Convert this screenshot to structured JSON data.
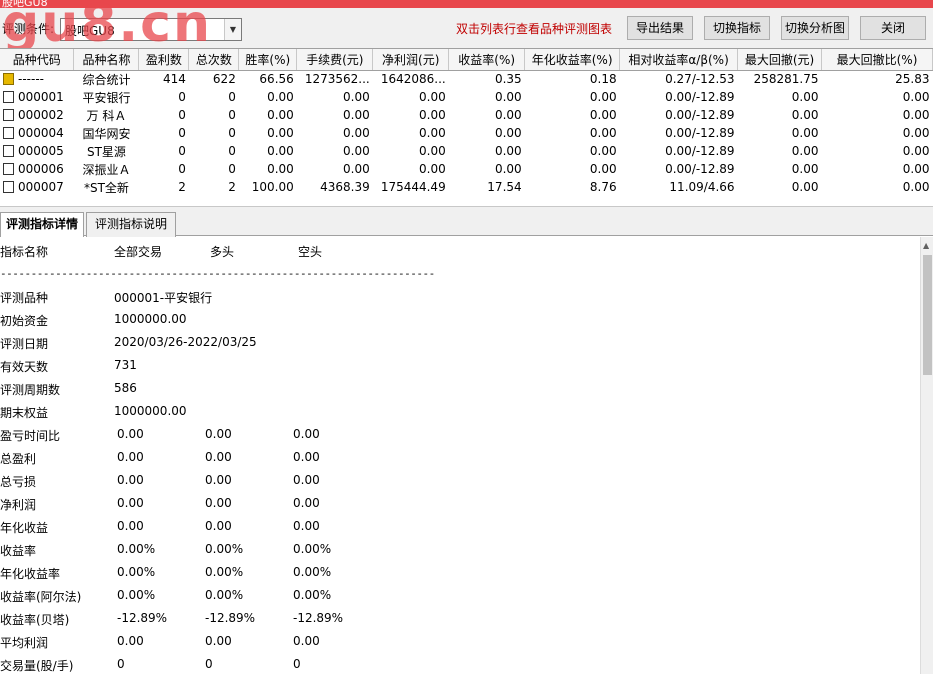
{
  "window": {
    "title": "股吧GU8"
  },
  "watermark": "gu8.cn",
  "toolbar": {
    "condition_label": "评测条件:",
    "condition_value": "股吧GU8",
    "hint": "双击列表行查看品种评测图表",
    "export_label": "导出结果",
    "switch_indicator_label": "切换指标",
    "switch_chart_label": "切换分析图",
    "close_label": "关闭"
  },
  "table": {
    "columns": [
      "品种代码",
      "品种名称",
      "盈利数",
      "总次数",
      "胜率(%)",
      "手续费(元)",
      "净利润(元)",
      "收益率(%)",
      "年化收益率(%)",
      "相对收益率α/β(%)",
      "最大回撤(元)",
      "最大回撤比(%)"
    ],
    "rows": [
      [
        "------",
        "综合统计",
        "414",
        "622",
        "66.56",
        "1273562...",
        "1642086...",
        "0.35",
        "0.18",
        "0.27/-12.53",
        "258281.75",
        "25.83"
      ],
      [
        "000001",
        "平安银行",
        "0",
        "0",
        "0.00",
        "0.00",
        "0.00",
        "0.00",
        "0.00",
        "0.00/-12.89",
        "0.00",
        "0.00"
      ],
      [
        "000002",
        "万 科Ａ",
        "0",
        "0",
        "0.00",
        "0.00",
        "0.00",
        "0.00",
        "0.00",
        "0.00/-12.89",
        "0.00",
        "0.00"
      ],
      [
        "000004",
        "国华网安",
        "0",
        "0",
        "0.00",
        "0.00",
        "0.00",
        "0.00",
        "0.00",
        "0.00/-12.89",
        "0.00",
        "0.00"
      ],
      [
        "000005",
        "ST星源",
        "0",
        "0",
        "0.00",
        "0.00",
        "0.00",
        "0.00",
        "0.00",
        "0.00/-12.89",
        "0.00",
        "0.00"
      ],
      [
        "000006",
        "深振业Ａ",
        "0",
        "0",
        "0.00",
        "0.00",
        "0.00",
        "0.00",
        "0.00",
        "0.00/-12.89",
        "0.00",
        "0.00"
      ],
      [
        "000007",
        "*ST全新",
        "2",
        "2",
        "100.00",
        "4368.39",
        "175444.49",
        "17.54",
        "8.76",
        "11.09/4.66",
        "0.00",
        "0.00"
      ]
    ]
  },
  "tabs": [
    "评测指标详情",
    "评测指标说明"
  ],
  "detail": {
    "headers": [
      "指标名称",
      "全部交易",
      "多头",
      "空头"
    ],
    "dash": "-----------------------------------------------------------------------",
    "rows": [
      {
        "name": "评测品种",
        "v1": "000001-平安银行",
        "v2": "",
        "v3": ""
      },
      {
        "name": "初始资金",
        "v1": "1000000.00",
        "v2": "",
        "v3": ""
      },
      {
        "name": "评测日期",
        "v1": "2020/03/26-2022/03/25",
        "v2": "",
        "v3": ""
      },
      {
        "name": "有效天数",
        "v1": "731",
        "v2": "",
        "v3": ""
      },
      {
        "name": "评测周期数",
        "v1": "586",
        "v2": "",
        "v3": ""
      },
      {
        "name": "期末权益",
        "v1": "1000000.00",
        "v2": "",
        "v3": ""
      },
      {
        "name": "盈亏时间比",
        "v1": "0.00",
        "v2": "0.00",
        "v3": "0.00"
      },
      {
        "name": "总盈利",
        "v1": "0.00",
        "v2": "0.00",
        "v3": "0.00"
      },
      {
        "name": "总亏损",
        "v1": "0.00",
        "v2": "0.00",
        "v3": "0.00"
      },
      {
        "name": "净利润",
        "v1": "0.00",
        "v2": "0.00",
        "v3": "0.00"
      },
      {
        "name": "年化收益",
        "v1": "0.00",
        "v2": "0.00",
        "v3": "0.00"
      },
      {
        "name": "收益率",
        "v1": "0.00%",
        "v2": "0.00%",
        "v3": "0.00%"
      },
      {
        "name": "年化收益率",
        "v1": "0.00%",
        "v2": "0.00%",
        "v3": "0.00%"
      },
      {
        "name": "收益率(阿尔法)",
        "v1": "0.00%",
        "v2": "0.00%",
        "v3": "0.00%"
      },
      {
        "name": "收益率(贝塔)",
        "v1": "-12.89%",
        "v2": "-12.89%",
        "v3": "-12.89%"
      },
      {
        "name": "平均利润",
        "v1": "0.00",
        "v2": "0.00",
        "v3": "0.00"
      },
      {
        "name": "交易量(股/手)",
        "v1": "0",
        "v2": "0",
        "v3": "0"
      }
    ]
  },
  "icons": {
    "summary_row": "summary-folder-icon",
    "data_row": "document-icon",
    "dropdown": "chevron-down-icon",
    "scroll_up": "scroll-up-icon"
  },
  "colors": {
    "title_bar": "#e8474c",
    "hint": "#c00000",
    "watermark": "#e8474c",
    "summary_icon": "#e6b800"
  }
}
